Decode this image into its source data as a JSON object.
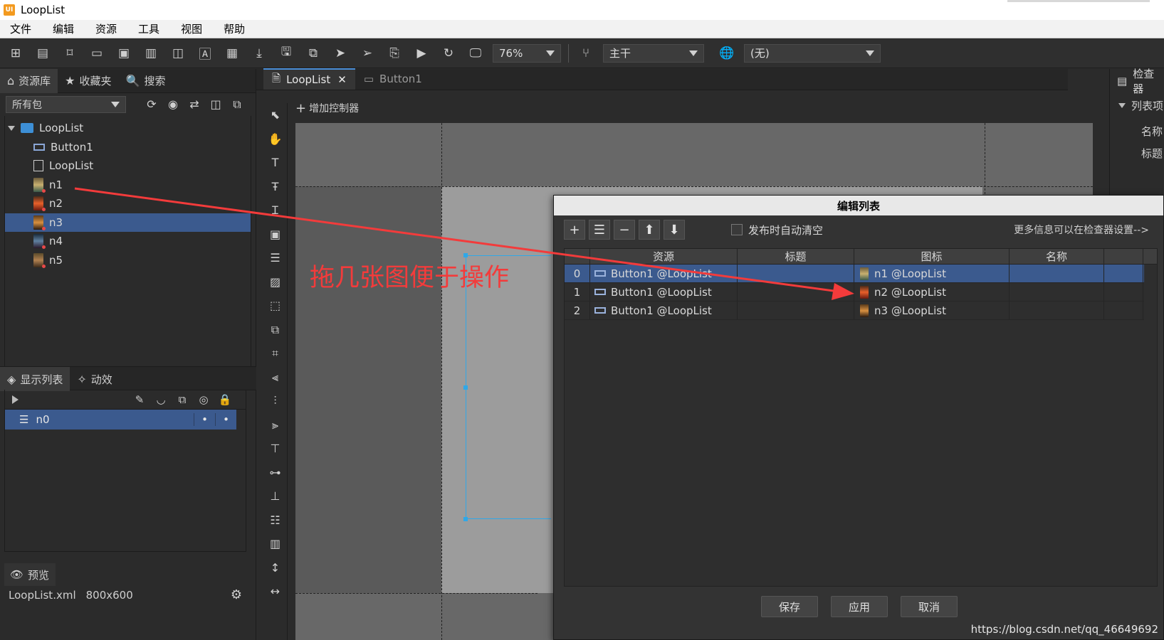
{
  "window": {
    "title": "LoopList",
    "logo_text": "UI"
  },
  "menu": [
    "文件",
    "编辑",
    "资源",
    "工具",
    "视图",
    "帮助"
  ],
  "toolbar": {
    "zoom": "76%",
    "branch": "主干",
    "language": "(无)"
  },
  "left_panel": {
    "tabs": {
      "library": "资源库",
      "favorites": "收藏夹",
      "search": "搜索"
    },
    "package_select": "所有包",
    "tree": {
      "root": "LoopList",
      "items": [
        "Button1",
        "LoopList",
        "n1",
        "n2",
        "n3",
        "n4",
        "n5"
      ],
      "selected": "n3"
    },
    "sub_tabs": {
      "display_list": "显示列表",
      "transition": "动效"
    },
    "display_list": {
      "row": "n0",
      "dot1": "•",
      "dot2": "•"
    },
    "preview_tab": "预览",
    "status": {
      "file": "LoopList.xml",
      "size": "800x600"
    }
  },
  "doc_tabs": [
    {
      "label": "LoopList",
      "active": true
    },
    {
      "label": "Button1",
      "active": false
    }
  ],
  "canvas": {
    "add_controller": "增加控制器",
    "annotation": "拖几张图便于操作"
  },
  "inspector": {
    "title": "检查器",
    "section": "列表项",
    "fields": [
      "名称",
      "标题"
    ]
  },
  "dialog": {
    "title": "编辑列表",
    "auto_clear_label": "发布时自动清空",
    "hint": "更多信息可以在检查器设置-->",
    "columns": [
      "资源",
      "标题",
      "图标",
      "名称"
    ],
    "rows": [
      {
        "index": "0",
        "resource": "Button1 @LoopList",
        "title": "",
        "icon": "n1 @LoopList",
        "name": ""
      },
      {
        "index": "1",
        "resource": "Button1 @LoopList",
        "title": "",
        "icon": "n2 @LoopList",
        "name": ""
      },
      {
        "index": "2",
        "resource": "Button1 @LoopList",
        "title": "",
        "icon": "n3 @LoopList",
        "name": ""
      }
    ],
    "selected_row": 0,
    "buttons": {
      "save": "保存",
      "apply": "应用",
      "cancel": "取消"
    }
  },
  "watermark": "https://blog.csdn.net/qq_46649692",
  "colors": {
    "selection": "#3b5a8e",
    "annotation": "#f33b3b",
    "accent": "#2fa8e8"
  }
}
